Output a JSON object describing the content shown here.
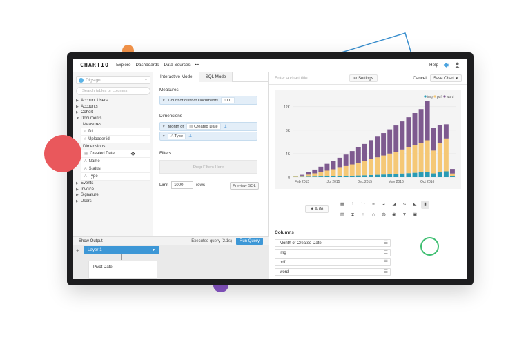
{
  "nav": {
    "logo": "CHARTIO",
    "links": [
      "Explore",
      "Dashboards",
      "Data Sources",
      "•••"
    ],
    "help": "Help"
  },
  "left": {
    "source": "Digsign",
    "search_placeholder": "Search tables or columns",
    "tables_top": [
      "Account Users",
      "Accounts",
      "Cohort",
      "Documents"
    ],
    "measures_label": "Measures",
    "measures": [
      "D1",
      "Uploader id"
    ],
    "dimensions_label": "Dimensions",
    "dimensions": [
      "Created Date",
      "Name",
      "Status",
      "Type"
    ],
    "tables_bottom": [
      "Events",
      "Invoice",
      "Signature",
      "Users"
    ]
  },
  "mid": {
    "tabs": [
      "Interactive Mode",
      "SQL Mode"
    ],
    "measures_label": "Measures",
    "measure_pill": {
      "agg": "Count of distinct Documents",
      "field": "D1"
    },
    "dimensions_label": "Dimensions",
    "dim_pill_1": {
      "prefix": "Month of",
      "field": "Created Date"
    },
    "dim_pill_2": {
      "field": "Type"
    },
    "filters_label": "Filters",
    "filters_drop": "Drop Filters Here",
    "limit_label": "Limit",
    "limit_value": "1000",
    "rows_label": "rows",
    "preview": "Preview SQL"
  },
  "status": {
    "show_output": "Show Output",
    "executed": "Executed query (2.1s)",
    "run": "Run Query"
  },
  "pipeline": {
    "layer": "Layer 1",
    "pivot": "Pivot Date"
  },
  "chart_header": {
    "title_placeholder": "Enter a chart title",
    "settings": "Settings",
    "cancel": "Cancel",
    "save": "Save Chart"
  },
  "chart_data": {
    "type": "bar",
    "stacked": true,
    "legend": "top-right",
    "x_tick_labels": [
      "Feb 2015",
      "Jul 2015",
      "Dec 2015",
      "May 2016",
      "Oct 2016"
    ],
    "x_tick_index": [
      1,
      6,
      11,
      16,
      21
    ],
    "y_ticks": [
      "0",
      "4K",
      "8K",
      "12K"
    ],
    "ylim": [
      0,
      12800
    ],
    "series": [
      {
        "name": "img",
        "color": "#2a9bb5",
        "values": [
          40,
          50,
          70,
          90,
          110,
          130,
          150,
          180,
          210,
          240,
          280,
          320,
          360,
          400,
          450,
          500,
          560,
          620,
          680,
          750,
          820,
          880,
          640,
          820,
          1000,
          120
        ]
      },
      {
        "name": "pdf",
        "color": "#f5c876",
        "values": [
          110,
          200,
          360,
          560,
          770,
          990,
          1200,
          1420,
          1680,
          1930,
          2180,
          2450,
          2720,
          2980,
          3240,
          3520,
          3780,
          4100,
          4420,
          4700,
          4980,
          5400,
          3900,
          5000,
          5600,
          500
        ]
      },
      {
        "name": "word",
        "color": "#7e5a8f",
        "values": [
          50,
          150,
          400,
          650,
          900,
          1150,
          1420,
          1700,
          1960,
          2280,
          2600,
          2880,
          3220,
          3520,
          3820,
          4130,
          4460,
          4780,
          5100,
          5470,
          5800,
          6700,
          3860,
          3080,
          2400,
          780
        ]
      }
    ]
  },
  "viz": {
    "auto": "Auto"
  },
  "columns": {
    "label": "Columns",
    "items": [
      "Month of Created Date",
      "img",
      "pdf",
      "word"
    ]
  }
}
